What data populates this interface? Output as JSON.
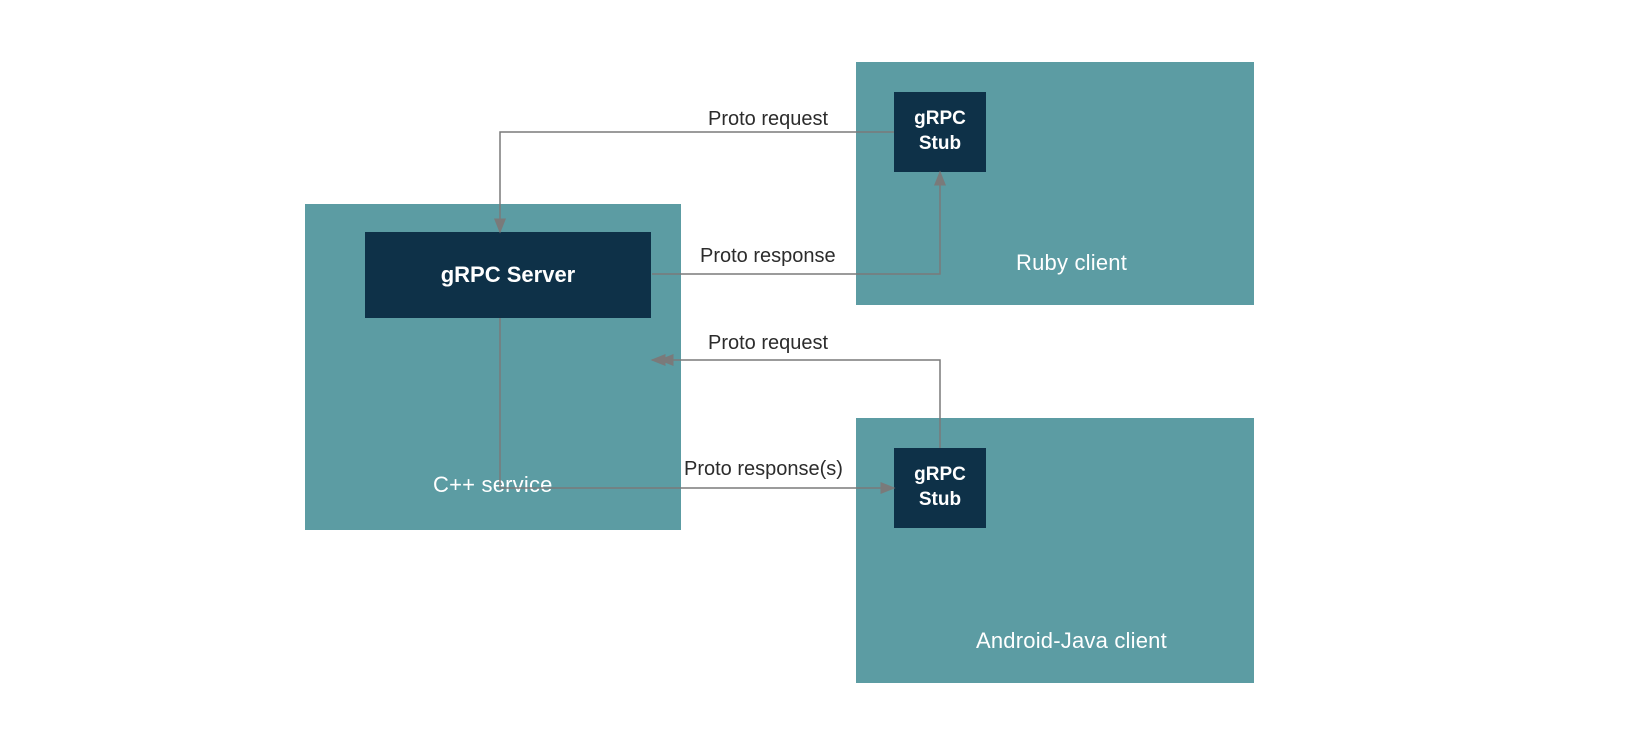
{
  "boxes": {
    "service": {
      "label": "C++ service",
      "inner_label": "gRPC Server"
    },
    "ruby": {
      "label": "Ruby client",
      "inner_label": "gRPC\nStub"
    },
    "android": {
      "label": "Android-Java client",
      "inner_label": "gRPC\nStub"
    }
  },
  "edges": {
    "ruby_to_server": {
      "label": "Proto request"
    },
    "server_to_ruby": {
      "label": "Proto response"
    },
    "android_to_server": {
      "label": "Proto request"
    },
    "server_to_android": {
      "label": "Proto response(s)"
    }
  },
  "colors": {
    "container": "#5c9ca3",
    "inner": "#0e3148",
    "arrow": "#7a7a7a"
  }
}
